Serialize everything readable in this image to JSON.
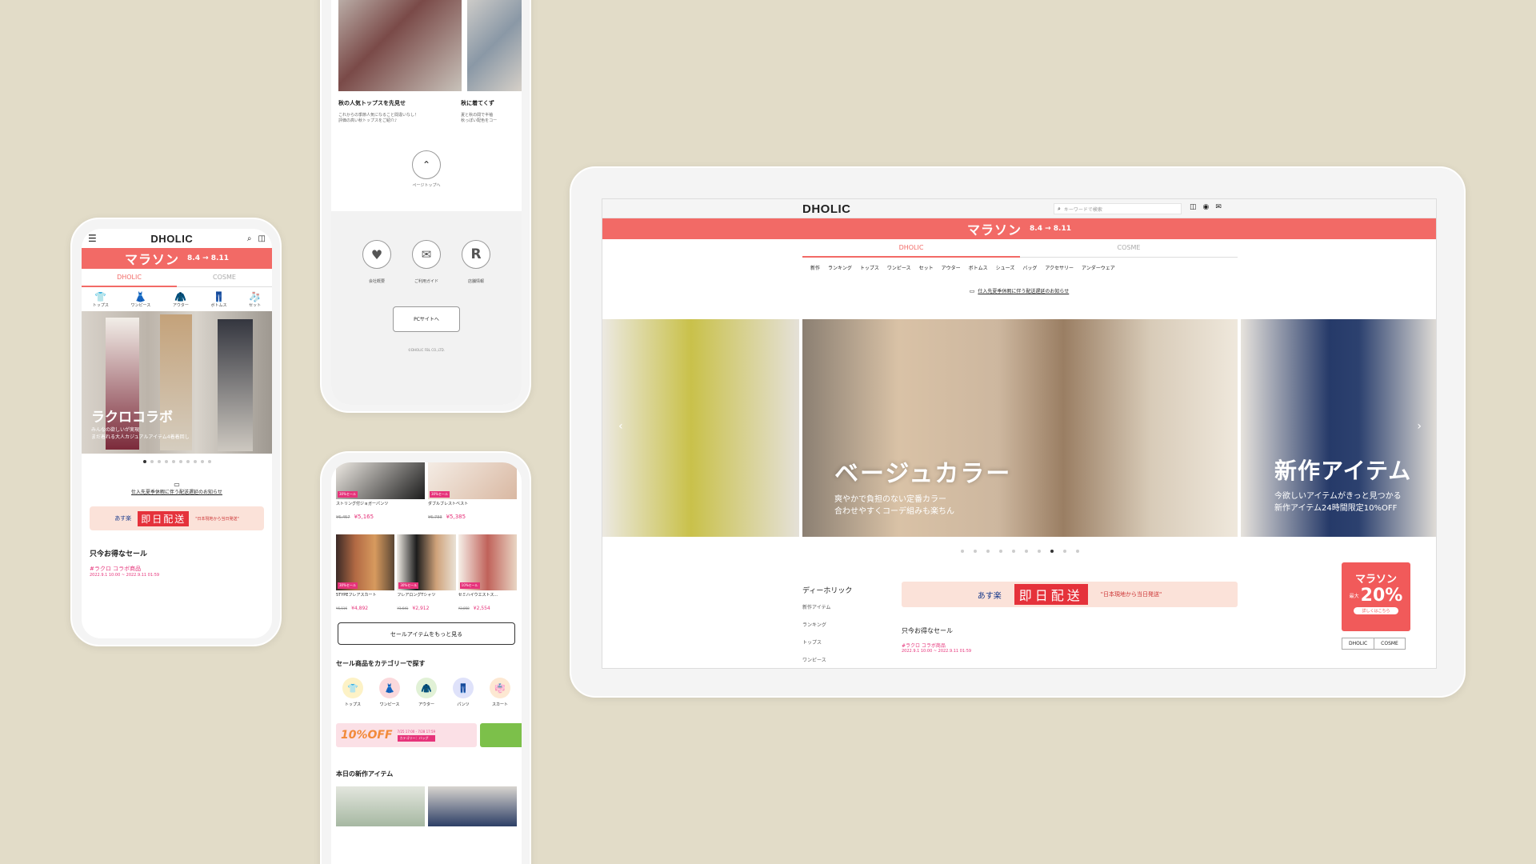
{
  "brand": "DHOLIC",
  "marathon": {
    "title": "マラソン",
    "dates": "8.4 → 8.11"
  },
  "tabs": [
    "DHOLIC",
    "COSME"
  ],
  "phone1": {
    "categories": [
      "トップス",
      "ワンピース",
      "アウター",
      "ボトムス",
      "セット"
    ],
    "hero_title": "ラクロコラボ",
    "hero_sub1": "みんなの欲しいが実現",
    "hero_sub2": "まだ着れる大人カジュアルアイテム4着着回し",
    "notice": "仕入先夏季休暇に伴う配送遅延のお知らせ",
    "banner_brand": "あす楽",
    "banner_main": "即日配送",
    "banner_note": "\"日本現地から当日発送\"",
    "sale_heading": "只今お得なセール",
    "sale_tag": "#ラクロ コラボ商品",
    "sale_period": "2022.9.1 10:00 ~ 2022.9.11 01:59"
  },
  "phone2": {
    "item1_title": "秋の人気トップスを先見せ",
    "item1_desc1": "これからの季節人気になること間違いなし！",
    "item1_desc2": "評価の高い秋トップスをご紹介♪",
    "item2_title": "秋に着てくず",
    "item2_desc1": "夏と秋の間で半袖",
    "item2_desc2": "秋っぽい配色をコー",
    "pagetop": "ページトップへ",
    "links": [
      "会社概要",
      "ご利用ガイド",
      "店舗情報"
    ],
    "pc_button": "PCサイトへ",
    "copyright": "©DHOLIC FBL CO.,LTD."
  },
  "phone3": {
    "products_top": [
      {
        "badge": "30%セール",
        "name": "ストリング付ジョガーパンツ",
        "old": "¥6,457",
        "price": "¥5,165"
      },
      {
        "badge": "30%セール",
        "name": "ダブルブレストベスト",
        "old": "¥6,733",
        "price": "¥5,385"
      }
    ],
    "products_mid": [
      {
        "badge": "30%セール",
        "name": "5TYPEフレアスカート",
        "old": "¥6,116",
        "price": "¥4,892"
      },
      {
        "badge": "30%セール",
        "name": "フレアロングTシャツ",
        "old": "¥3,641",
        "price": "¥2,912"
      },
      {
        "badge": "10%セール",
        "name": "セミハイウエストス...",
        "old": "¥2,858",
        "price": "¥2,554"
      }
    ],
    "more_button": "セールアイテムをもっと見る",
    "category_heading": "セール商品をカテゴリーで探す",
    "categories": [
      "トップス",
      "ワンピース",
      "アウター",
      "パンツ",
      "スカート"
    ],
    "coupon": "10%OFF",
    "coupon_period": "7/25 17:00 - 7/28 17:59",
    "coupon_target": "カテゴリー：バッグ",
    "new_heading": "本日の新作アイテム"
  },
  "tablet": {
    "search_placeholder": "キーワードで検索",
    "nav": [
      "新作",
      "ランキング",
      "トップス",
      "ワンピース",
      "セット",
      "アウター",
      "ボトムス",
      "シューズ",
      "バッグ",
      "アクセサリー",
      "アンダーウェア"
    ],
    "notice": "仕入先夏季休暇に伴う配送遅延のお知らせ",
    "hero1_title": "ベージュカラー",
    "hero1_sub1": "爽やかで負担のない定番カラー",
    "hero1_sub2": "合わせやすくコーデ組みも楽ちん",
    "hero2_title": "新作アイテム",
    "hero2_sub1": "今欲しいアイテムがきっと見つかる",
    "hero2_sub2": "新作アイテム24時間限定10%OFF",
    "side_heading": "ディーホリック",
    "side_links": [
      "新作アイテム",
      "ランキング",
      "トップス",
      "ワンピース"
    ],
    "banner_brand": "あす楽",
    "banner_main": "即日配送",
    "banner_note": "\"日本現地から当日発送\"",
    "sale_heading": "只今お得なセール",
    "sale_tag": "#ラクロ コラボ商品",
    "sale_period": "2022.9.1 10:00 ~ 2022.9.11 01:59",
    "badge_title": "マラソン",
    "badge_label": "最大",
    "badge_pct": "20%",
    "badge_button": "詳しくはこちら",
    "switch": [
      "DHOLIC",
      "COSME"
    ]
  },
  "colors": {
    "accent": "#f26a66",
    "pink": "#e6337a",
    "bg": "#e2dcc8"
  }
}
